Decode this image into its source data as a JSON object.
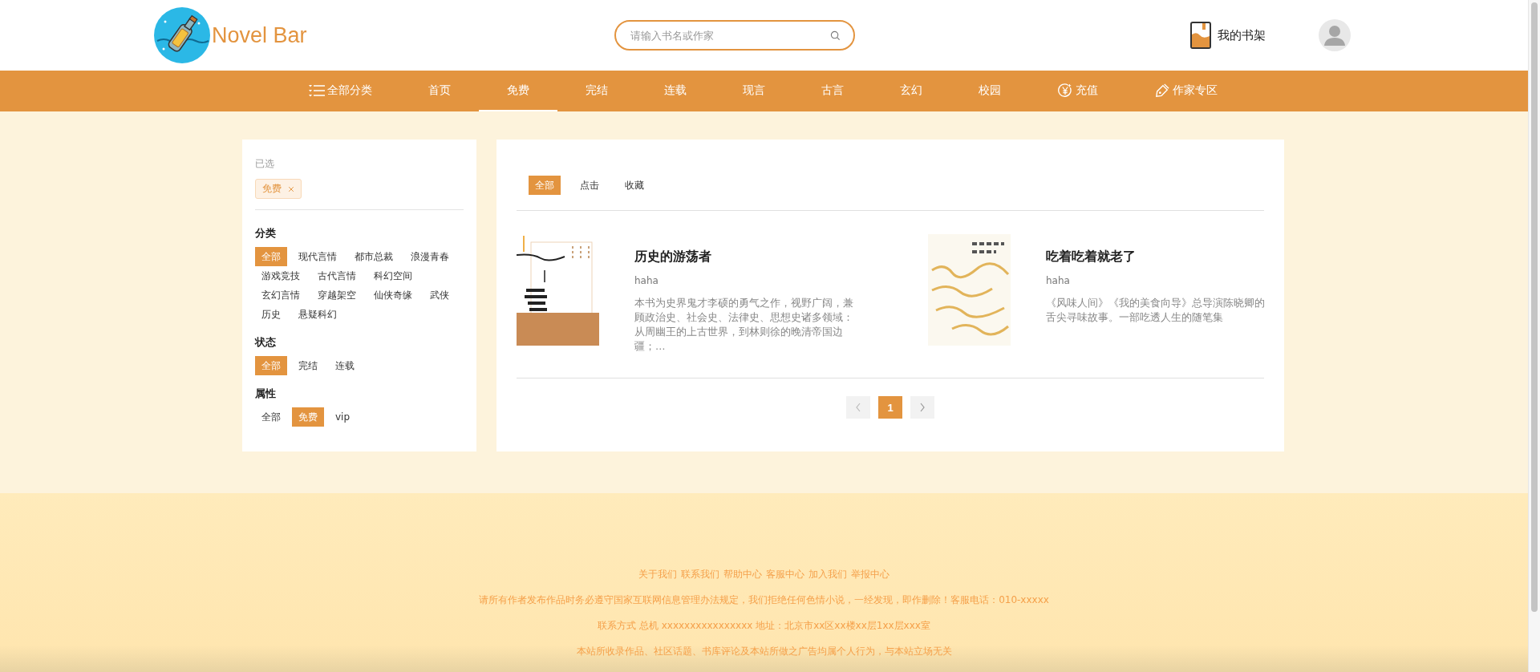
{
  "header": {
    "logo_text": "Novel Bar",
    "search": {
      "placeholder": "请输入书名或作家"
    },
    "bookshelf": "我的书架"
  },
  "nav": [
    {
      "label": "全部分类",
      "kind": "categories",
      "selected": false
    },
    {
      "label": "首页",
      "kind": "plain",
      "selected": false
    },
    {
      "label": "免费",
      "kind": "plain",
      "selected": true
    },
    {
      "label": "完结",
      "kind": "plain",
      "selected": false
    },
    {
      "label": "连载",
      "kind": "plain",
      "selected": false
    },
    {
      "label": "现言",
      "kind": "plain",
      "selected": false
    },
    {
      "label": "古言",
      "kind": "plain",
      "selected": false
    },
    {
      "label": "玄幻",
      "kind": "plain",
      "selected": false
    },
    {
      "label": "校园",
      "kind": "plain",
      "selected": false
    },
    {
      "label": "充值",
      "kind": "recharge",
      "selected": false
    },
    {
      "label": "作家专区",
      "kind": "author",
      "selected": false
    }
  ],
  "filters": {
    "selected_label": "已选",
    "selected_tags": [
      "免费"
    ],
    "groups": [
      {
        "title": "分类",
        "options": [
          {
            "label": "全部",
            "selected": true
          },
          {
            "label": "现代言情",
            "selected": false
          },
          {
            "label": "都市总裁",
            "selected": false
          },
          {
            "label": "浪漫青春",
            "selected": false
          },
          {
            "label": "游戏竞技",
            "selected": false
          },
          {
            "label": "古代言情",
            "selected": false
          },
          {
            "label": "科幻空间",
            "selected": false
          },
          {
            "label": "玄幻言情",
            "selected": false
          },
          {
            "label": "穿越架空",
            "selected": false
          },
          {
            "label": "仙侠奇缘",
            "selected": false
          },
          {
            "label": "武侠",
            "selected": false
          },
          {
            "label": "历史",
            "selected": false
          },
          {
            "label": "悬疑科幻",
            "selected": false
          }
        ]
      },
      {
        "title": "状态",
        "options": [
          {
            "label": "全部",
            "selected": true
          },
          {
            "label": "完结",
            "selected": false
          },
          {
            "label": "连载",
            "selected": false
          }
        ]
      },
      {
        "title": "属性",
        "options": [
          {
            "label": "全部",
            "selected": false
          },
          {
            "label": "免费",
            "selected": true
          },
          {
            "label": "vip",
            "selected": false
          }
        ]
      }
    ]
  },
  "sort_tabs": [
    {
      "label": "全部",
      "selected": true
    },
    {
      "label": "点击",
      "selected": false
    },
    {
      "label": "收藏",
      "selected": false
    }
  ],
  "books": [
    {
      "kind": "ink",
      "title": "历史的游荡者",
      "author": "haha",
      "description": "本书为史界鬼才李硕的勇气之作，视野广阔，兼顾政治史、社会史、法律史、思想史诸多领域：从周幽王的上古世界，到林则徐的晚清帝国边疆；…"
    },
    {
      "kind": "script",
      "title": "吃着吃着就老了",
      "author": "haha",
      "description": "《风味人间》《我的美食向导》总导演陈晓卿的舌尖寻味故事。一部吃透人生的随笔集"
    }
  ],
  "pagination": {
    "pages": [
      {
        "label": "1",
        "selected": true
      }
    ]
  },
  "footer": {
    "links": [
      "关于我们",
      "联系我们",
      "帮助中心",
      "客服中心",
      "加入我们",
      "举报中心"
    ],
    "lines": [
      "请所有作者发布作品时务必遵守国家互联网信息管理办法规定，我们拒绝任何色情小说，一经发现，即作删除！客服电话：010-xxxxx",
      "联系方式 总机 xxxxxxxxxxxxxxxx 地址：北京市xx区xx楼xx层1xx层xxx室",
      "本站所收录作品、社区话题、书库评论及本站所做之广告均属个人行为，与本站立场无关"
    ]
  }
}
